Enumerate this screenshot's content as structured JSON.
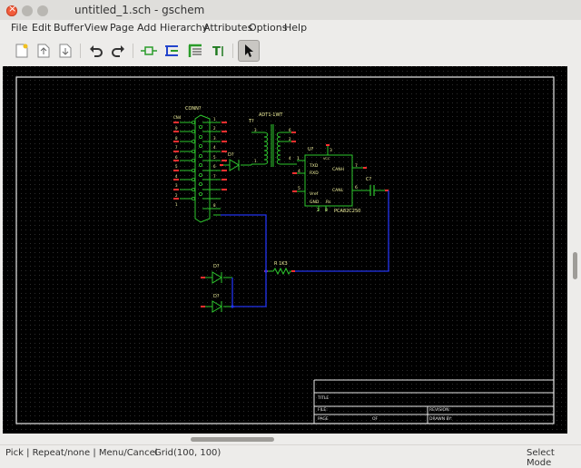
{
  "window": {
    "title": "untitled_1.sch - gschem"
  },
  "menu": [
    "File",
    "Edit",
    "Buffer",
    "View",
    "Page",
    "Add",
    "Hierarchy",
    "Attributes",
    "Options",
    "Help"
  ],
  "toolbar": {
    "tools": [
      "new-page-icon",
      "open-file-icon",
      "save-file-icon",
      "undo-icon",
      "redo-icon",
      "add-component-icon",
      "add-net-icon",
      "add-bus-icon",
      "add-text-icon",
      "select-arrow-icon"
    ],
    "active": "select-arrow-icon"
  },
  "schematic": {
    "connector": {
      "ref": "CONN?",
      "pins_left": [
        "9",
        "8",
        "7",
        "6",
        "5",
        "4",
        "3",
        "2",
        "1"
      ],
      "pins_right": [
        "1",
        "2",
        "3",
        "4",
        "5",
        "6",
        "7",
        "8"
      ],
      "left_label": "CN4"
    },
    "transformer": {
      "ref": "T?",
      "value": "ADT1-1WT",
      "pins": [
        "3",
        "6",
        "2",
        "1",
        "4",
        "4"
      ]
    },
    "diode_top": "D?",
    "ic": {
      "ref": "U?",
      "value": "PCA82C250",
      "pin_labels": [
        "TXD",
        "RXD",
        "Vref",
        "GND",
        "Rs",
        "CANH",
        "CANL",
        "VCC"
      ],
      "pin_numbers": [
        "1",
        "4",
        "5",
        "6",
        "7",
        "3",
        "2",
        "8"
      ]
    },
    "capacitor": "C?",
    "resistor": "R 1K3",
    "diodes_bottom": [
      "D?",
      "D?"
    ],
    "titleblock": {
      "title": "TITLE",
      "file": "FILE:",
      "page": "PAGE",
      "of": "OF",
      "revision": "REVISION:",
      "drawn_by": "DRAWN BY:"
    }
  },
  "status": {
    "pick": "Pick",
    "repeat": "Repeat/none",
    "menu": "Menu/Cancel",
    "grid": "Grid(100, 100)",
    "mode": "Select Mode"
  }
}
